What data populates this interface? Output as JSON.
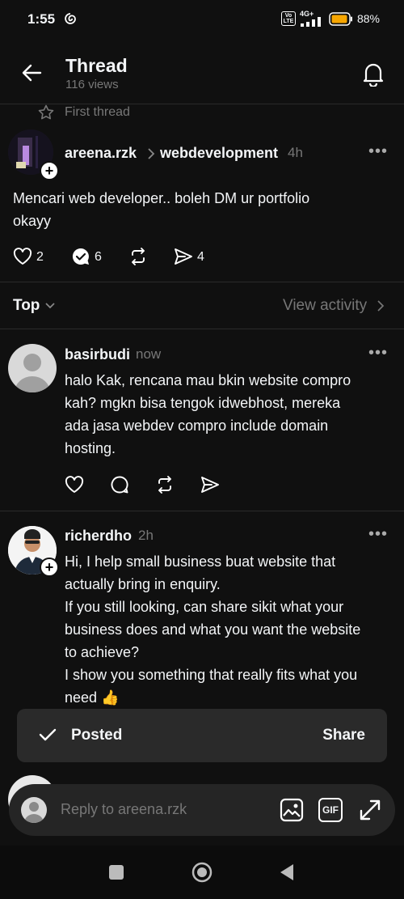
{
  "status_bar": {
    "time": "1:55",
    "battery_pct": "88%",
    "network": "4G+",
    "volte": "Vo LTE"
  },
  "header": {
    "title": "Thread",
    "views": "116 views"
  },
  "first_thread_label": "First thread",
  "main_post": {
    "username": "areena.rzk",
    "topic": "webdevelopment",
    "time": "4h",
    "text_line1": "Mencari web developer.. boleh DM ur portfolio",
    "text_line2": "okayy",
    "likes": "2",
    "replies": "6",
    "shares": "4"
  },
  "sort": {
    "label": "Top",
    "view_activity": "View activity"
  },
  "replies": [
    {
      "username": "basirbudi",
      "time": "now",
      "lines": [
        "halo Kak, rencana mau bkin website compro",
        "kah? mgkn bisa tengok idwebhost, mereka",
        "ada jasa webdev compro include domain",
        "hosting."
      ]
    },
    {
      "username": "richerdho",
      "time": "2h",
      "lines": [
        "Hi, I help small business buat website that",
        "actually bring in enquiry.",
        "If you still looking, can share sikit what your",
        "business does and what you want the website",
        "to achieve?",
        "I show you something that really fits what you",
        "need 👍"
      ]
    }
  ],
  "toast": {
    "status": "Posted",
    "action": "Share"
  },
  "reply_bar": {
    "placeholder": "Reply to areena.rzk",
    "gif_label": "GIF"
  },
  "colors": {
    "background": "#101010",
    "text": "#f3f5f7",
    "muted": "#777777",
    "toast": "#2a2a2a"
  }
}
